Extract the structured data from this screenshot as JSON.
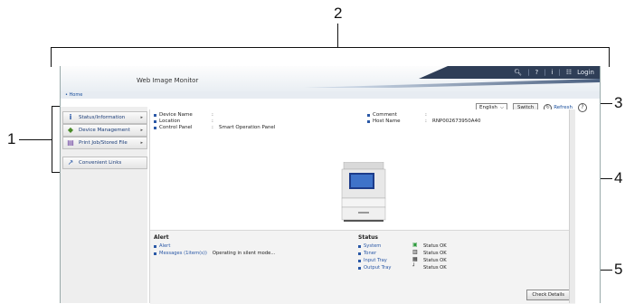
{
  "callouts": {
    "c1": "1",
    "c2": "2",
    "c3": "3",
    "c4": "4",
    "c5": "5"
  },
  "header": {
    "app_title": "Web Image Monitor",
    "icons": [
      "search-icon",
      "help-icon",
      "info-icon",
      "grid-icon"
    ],
    "login_label": "Login"
  },
  "breadcrumb": {
    "home": "• Home"
  },
  "controls": {
    "language": "English",
    "switch_label": "Switch",
    "refresh_label": "Refresh"
  },
  "sidebar": {
    "items": [
      {
        "label": "Status/Information",
        "icon": "info-icon"
      },
      {
        "label": "Device Management",
        "icon": "diamond-icon"
      },
      {
        "label": "Print Job/Stored File",
        "icon": "document-icon"
      },
      {
        "label": "Convenient Links",
        "icon": "link-arrow-icon"
      }
    ]
  },
  "device_info": {
    "left": [
      {
        "key": "Device Name",
        "value": ""
      },
      {
        "key": "Location",
        "value": ""
      },
      {
        "key": "Control Panel",
        "value": "Smart Operation Panel"
      }
    ],
    "right": [
      {
        "key": "Comment",
        "value": ""
      },
      {
        "key": "Host Name",
        "value": "RNP002673950A40"
      }
    ]
  },
  "alert": {
    "title": "Alert",
    "alert_link": "Alert",
    "messages_link": "Messages (1item(s))",
    "messages_text": "Operating in silent mode..."
  },
  "status": {
    "title": "Status",
    "rows": [
      {
        "label": "System",
        "icon": "system-icon",
        "value": "Status OK"
      },
      {
        "label": "Toner",
        "icon": "toner-icon",
        "value": "Status OK"
      },
      {
        "label": "Input Tray",
        "icon": "input-tray-icon",
        "value": "Status OK"
      },
      {
        "label": "Output Tray",
        "icon": "output-tray-icon",
        "value": "Status OK"
      }
    ],
    "check_details": "Check Details"
  }
}
